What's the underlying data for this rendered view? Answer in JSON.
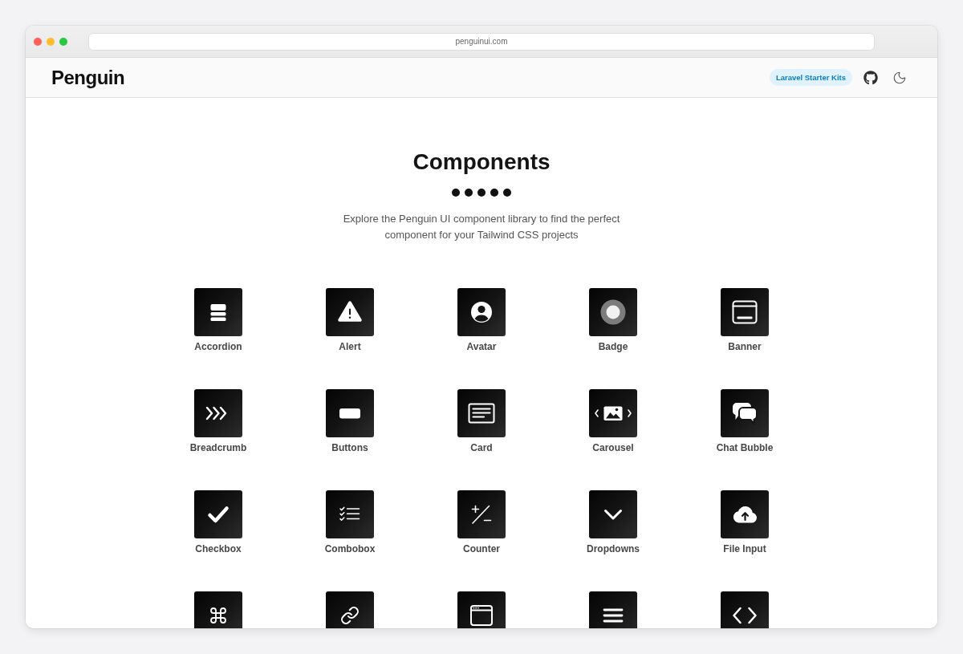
{
  "browser": {
    "url": "penguinui.com"
  },
  "header": {
    "logo": "Penguin",
    "badge": "Laravel Starter Kits"
  },
  "intro": {
    "title": "Components",
    "description": "Explore the Penguin UI component library to find the perfect component for your Tailwind CSS projects"
  },
  "components": [
    {
      "label": "Accordion",
      "kind": "stack"
    },
    {
      "label": "Alert",
      "kind": "warning"
    },
    {
      "label": "Avatar",
      "kind": "user"
    },
    {
      "label": "Badge",
      "kind": "ring"
    },
    {
      "label": "Banner",
      "kind": "banner"
    },
    {
      "label": "Breadcrumb",
      "kind": "chevrons"
    },
    {
      "label": "Buttons",
      "kind": "pill"
    },
    {
      "label": "Card",
      "kind": "card"
    },
    {
      "label": "Carousel",
      "kind": "carousel"
    },
    {
      "label": "Chat Bubble",
      "kind": "chat"
    },
    {
      "label": "Checkbox",
      "kind": "check"
    },
    {
      "label": "Combobox",
      "kind": "checklist"
    },
    {
      "label": "Counter",
      "kind": "plusminus"
    },
    {
      "label": "Dropdowns",
      "kind": "chevron"
    },
    {
      "label": "File Input",
      "kind": "upload"
    },
    {
      "kind": "command"
    },
    {
      "kind": "link"
    },
    {
      "kind": "window"
    },
    {
      "kind": "menu"
    },
    {
      "kind": "code"
    }
  ]
}
